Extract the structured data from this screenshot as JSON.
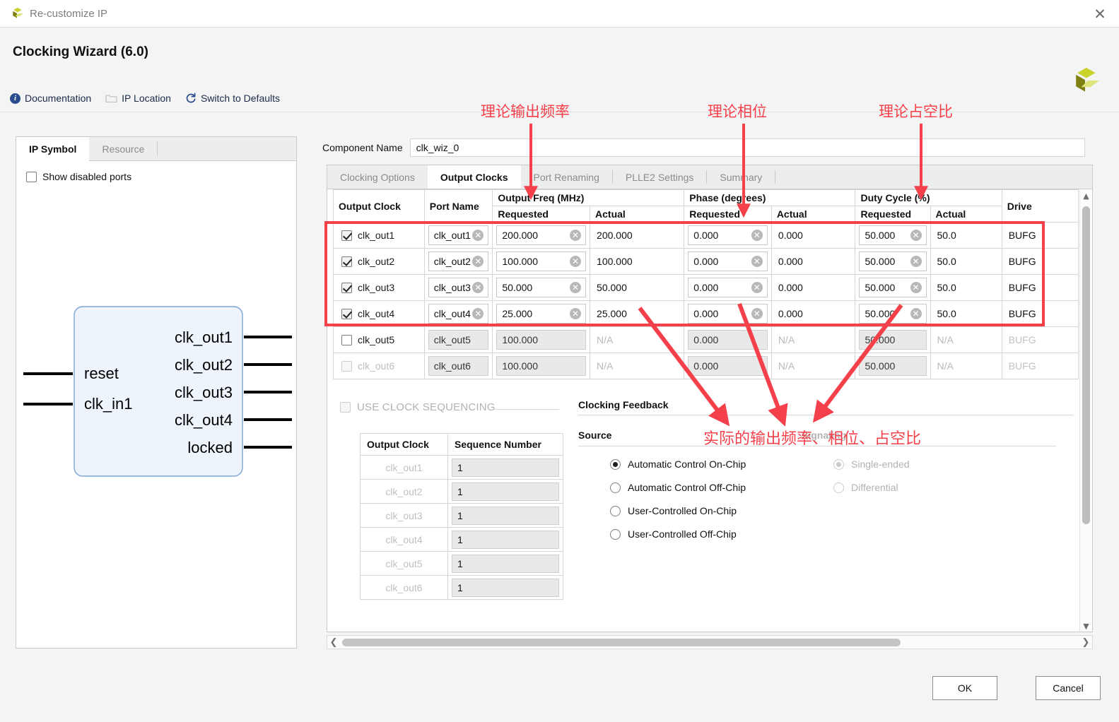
{
  "window": {
    "title": "Re-customize IP",
    "close_icon": "close-icon",
    "logo_icon": "xilinx-logo-icon"
  },
  "header": {
    "wizard_title": "Clocking Wizard (6.0)",
    "toolbar": [
      {
        "label": "Documentation",
        "icon": "info-icon"
      },
      {
        "label": "IP Location",
        "icon": "folder-icon"
      },
      {
        "label": "Switch to Defaults",
        "icon": "refresh-icon"
      }
    ]
  },
  "left_panel": {
    "tabs": [
      {
        "label": "IP Symbol",
        "active": true
      },
      {
        "label": "Resource",
        "active": false
      }
    ],
    "show_disabled_ports": {
      "label": "Show disabled ports",
      "checked": false
    },
    "symbol": {
      "inputs": [
        "reset",
        "clk_in1"
      ],
      "outputs": [
        "clk_out1",
        "clk_out2",
        "clk_out3",
        "clk_out4",
        "locked"
      ]
    }
  },
  "main": {
    "component_name": {
      "label": "Component Name",
      "value": "clk_wiz_0"
    },
    "tabs": [
      {
        "label": "Clocking Options",
        "active": false
      },
      {
        "label": "Output Clocks",
        "active": true
      },
      {
        "label": "Port Renaming",
        "active": false
      },
      {
        "label": "PLLE2 Settings",
        "active": false
      },
      {
        "label": "Summary",
        "active": false
      }
    ],
    "clock_table": {
      "group_headers": [
        "Output Clock",
        "Port Name",
        "Output Freq (MHz)",
        "Phase (degrees)",
        "Duty Cycle (%)",
        "Drive"
      ],
      "sub_headers": [
        "Requested",
        "Actual"
      ],
      "rows": [
        {
          "name": "clk_out1",
          "enabled": true,
          "dim": false,
          "port_name": "clk_out1",
          "freq_requested": "200.000",
          "freq_actual": "200.000",
          "phase_requested": "0.000",
          "phase_actual": "0.000",
          "duty_requested": "50.000",
          "duty_actual": "50.0",
          "drive": "BUFG"
        },
        {
          "name": "clk_out2",
          "enabled": true,
          "dim": false,
          "port_name": "clk_out2",
          "freq_requested": "100.000",
          "freq_actual": "100.000",
          "phase_requested": "0.000",
          "phase_actual": "0.000",
          "duty_requested": "50.000",
          "duty_actual": "50.0",
          "drive": "BUFG"
        },
        {
          "name": "clk_out3",
          "enabled": true,
          "dim": false,
          "port_name": "clk_out3",
          "freq_requested": "50.000",
          "freq_actual": "50.000",
          "phase_requested": "0.000",
          "phase_actual": "0.000",
          "duty_requested": "50.000",
          "duty_actual": "50.0",
          "drive": "BUFG"
        },
        {
          "name": "clk_out4",
          "enabled": true,
          "dim": false,
          "port_name": "clk_out4",
          "freq_requested": "25.000",
          "freq_actual": "25.000",
          "phase_requested": "0.000",
          "phase_actual": "0.000",
          "duty_requested": "50.000",
          "duty_actual": "50.0",
          "drive": "BUFG"
        },
        {
          "name": "clk_out5",
          "enabled": false,
          "dim": false,
          "port_name": "clk_out5",
          "freq_requested": "100.000",
          "freq_actual": "N/A",
          "phase_requested": "0.000",
          "phase_actual": "N/A",
          "duty_requested": "50.000",
          "duty_actual": "N/A",
          "drive": "BUFG"
        },
        {
          "name": "clk_out6",
          "enabled": false,
          "dim": true,
          "port_name": "clk_out6",
          "freq_requested": "100.000",
          "freq_actual": "N/A",
          "phase_requested": "0.000",
          "phase_actual": "N/A",
          "duty_requested": "50.000",
          "duty_actual": "N/A",
          "drive": "BUFG"
        }
      ]
    },
    "sequencing": {
      "checkbox_label": "USE CLOCK SEQUENCING",
      "checked": false,
      "headers": [
        "Output Clock",
        "Sequence Number"
      ],
      "rows": [
        {
          "clock": "clk_out1",
          "sequence": "1"
        },
        {
          "clock": "clk_out2",
          "sequence": "1"
        },
        {
          "clock": "clk_out3",
          "sequence": "1"
        },
        {
          "clock": "clk_out4",
          "sequence": "1"
        },
        {
          "clock": "clk_out5",
          "sequence": "1"
        },
        {
          "clock": "clk_out6",
          "sequence": "1"
        }
      ]
    },
    "clocking_feedback": {
      "title": "Clocking Feedback",
      "source": {
        "label": "Source",
        "options": [
          {
            "label": "Automatic Control On-Chip",
            "selected": true,
            "disabled": false
          },
          {
            "label": "Automatic Control Off-Chip",
            "selected": false,
            "disabled": false
          },
          {
            "label": "User-Controlled On-Chip",
            "selected": false,
            "disabled": false
          },
          {
            "label": "User-Controlled Off-Chip",
            "selected": false,
            "disabled": false
          }
        ]
      },
      "signaling": {
        "label": "Signaling",
        "options": [
          {
            "label": "Single-ended",
            "selected": true,
            "disabled": true
          },
          {
            "label": "Differential",
            "selected": false,
            "disabled": true
          }
        ]
      }
    }
  },
  "footer": {
    "ok_label": "OK",
    "cancel_label": "Cancel"
  },
  "annotations": {
    "color": "#f4404a",
    "freq": "理论输出频率",
    "phase": "理论相位",
    "duty": "理论占空比",
    "actual": "实际的输出频率、相位、占空比"
  }
}
